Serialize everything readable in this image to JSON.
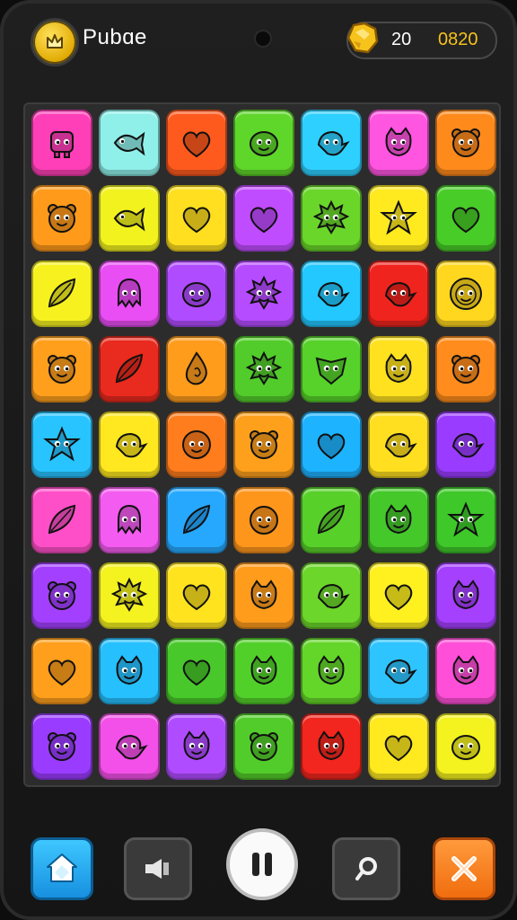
{
  "header": {
    "title": "Pubɑe",
    "level": "20",
    "score": "0820",
    "badge_icon": "crown-icon",
    "currency_icon": "gold-nugget-icon"
  },
  "board": {
    "rows": 9,
    "cols": 7,
    "tiles": [
      [
        {
          "color": "#ff3fb7",
          "creature": "robot"
        },
        {
          "color": "#8ff0ea",
          "creature": "fish"
        },
        {
          "color": "#ff5a1e",
          "creature": "heart"
        },
        {
          "color": "#5fd62a",
          "creature": "blob"
        },
        {
          "color": "#2ed0ff",
          "creature": "bird"
        },
        {
          "color": "#ff55e0",
          "creature": "cat"
        },
        {
          "color": "#ff8a1c",
          "creature": "bear"
        }
      ],
      [
        {
          "color": "#ff9a1a",
          "creature": "bear"
        },
        {
          "color": "#f2f21f",
          "creature": "fish"
        },
        {
          "color": "#ffdf1f",
          "creature": "heart"
        },
        {
          "color": "#c04cff",
          "creature": "heart"
        },
        {
          "color": "#6ad62a",
          "creature": "spiky"
        },
        {
          "color": "#ffe91f",
          "creature": "star"
        },
        {
          "color": "#48cc28",
          "creature": "heart"
        }
      ],
      [
        {
          "color": "#f7f21f",
          "creature": "leaf"
        },
        {
          "color": "#e94df4",
          "creature": "squid"
        },
        {
          "color": "#b04cff",
          "creature": "blob"
        },
        {
          "color": "#b64cff",
          "creature": "spiky"
        },
        {
          "color": "#22c8ff",
          "creature": "bird"
        },
        {
          "color": "#f0241e",
          "creature": "bird"
        },
        {
          "color": "#ffd71f",
          "creature": "lion"
        }
      ],
      [
        {
          "color": "#ff9f1c",
          "creature": "bear"
        },
        {
          "color": "#e92a1e",
          "creature": "leaf"
        },
        {
          "color": "#ff9c1c",
          "creature": "drop"
        },
        {
          "color": "#52cc2a",
          "creature": "spiky"
        },
        {
          "color": "#56d22a",
          "creature": "shield"
        },
        {
          "color": "#ffe11f",
          "creature": "cat"
        },
        {
          "color": "#ff8c1c",
          "creature": "bear"
        }
      ],
      [
        {
          "color": "#28c4ff",
          "creature": "star"
        },
        {
          "color": "#ffe81f",
          "creature": "bird"
        },
        {
          "color": "#ff7d1c",
          "creature": "face"
        },
        {
          "color": "#ffa01c",
          "creature": "bear"
        },
        {
          "color": "#1eb3ff",
          "creature": "heart"
        },
        {
          "color": "#ffdf1f",
          "creature": "bird"
        },
        {
          "color": "#9a3cff",
          "creature": "bird"
        }
      ],
      [
        {
          "color": "#ff4fc8",
          "creature": "leaf"
        },
        {
          "color": "#f45bf0",
          "creature": "squid"
        },
        {
          "color": "#26a8ff",
          "creature": "leaf"
        },
        {
          "color": "#ff961c",
          "creature": "face"
        },
        {
          "color": "#58d02a",
          "creature": "leaf"
        },
        {
          "color": "#44c82a",
          "creature": "cat"
        },
        {
          "color": "#3ec82a",
          "creature": "star"
        }
      ],
      [
        {
          "color": "#a340ff",
          "creature": "bear"
        },
        {
          "color": "#f4f21f",
          "creature": "spiky"
        },
        {
          "color": "#ffe31f",
          "creature": "heart"
        },
        {
          "color": "#ff9c1c",
          "creature": "cat"
        },
        {
          "color": "#6cd62a",
          "creature": "bird"
        },
        {
          "color": "#fff01f",
          "creature": "heart"
        },
        {
          "color": "#a540ff",
          "creature": "cat"
        }
      ],
      [
        {
          "color": "#ff9f1c",
          "creature": "heart"
        },
        {
          "color": "#26c0ff",
          "creature": "cat"
        },
        {
          "color": "#48c82a",
          "creature": "heart"
        },
        {
          "color": "#52d02a",
          "creature": "cat"
        },
        {
          "color": "#64d62a",
          "creature": "cat"
        },
        {
          "color": "#2ec4ff",
          "creature": "bird"
        },
        {
          "color": "#ff4fd8",
          "creature": "cat"
        }
      ],
      [
        {
          "color": "#9a3cff",
          "creature": "bear"
        },
        {
          "color": "#f250e8",
          "creature": "bird"
        },
        {
          "color": "#b04cff",
          "creature": "cat"
        },
        {
          "color": "#52cc2a",
          "creature": "bear"
        },
        {
          "color": "#f2261e",
          "creature": "cat"
        },
        {
          "color": "#ffe91f",
          "creature": "heart"
        },
        {
          "color": "#f4f21f",
          "creature": "blob"
        }
      ]
    ]
  },
  "controls": {
    "home_icon": "home-icon",
    "sound_icon": "sound-icon",
    "pause_icon": "pause-icon",
    "search_icon": "search-icon",
    "shuffle_icon": "shuffle-icon"
  }
}
